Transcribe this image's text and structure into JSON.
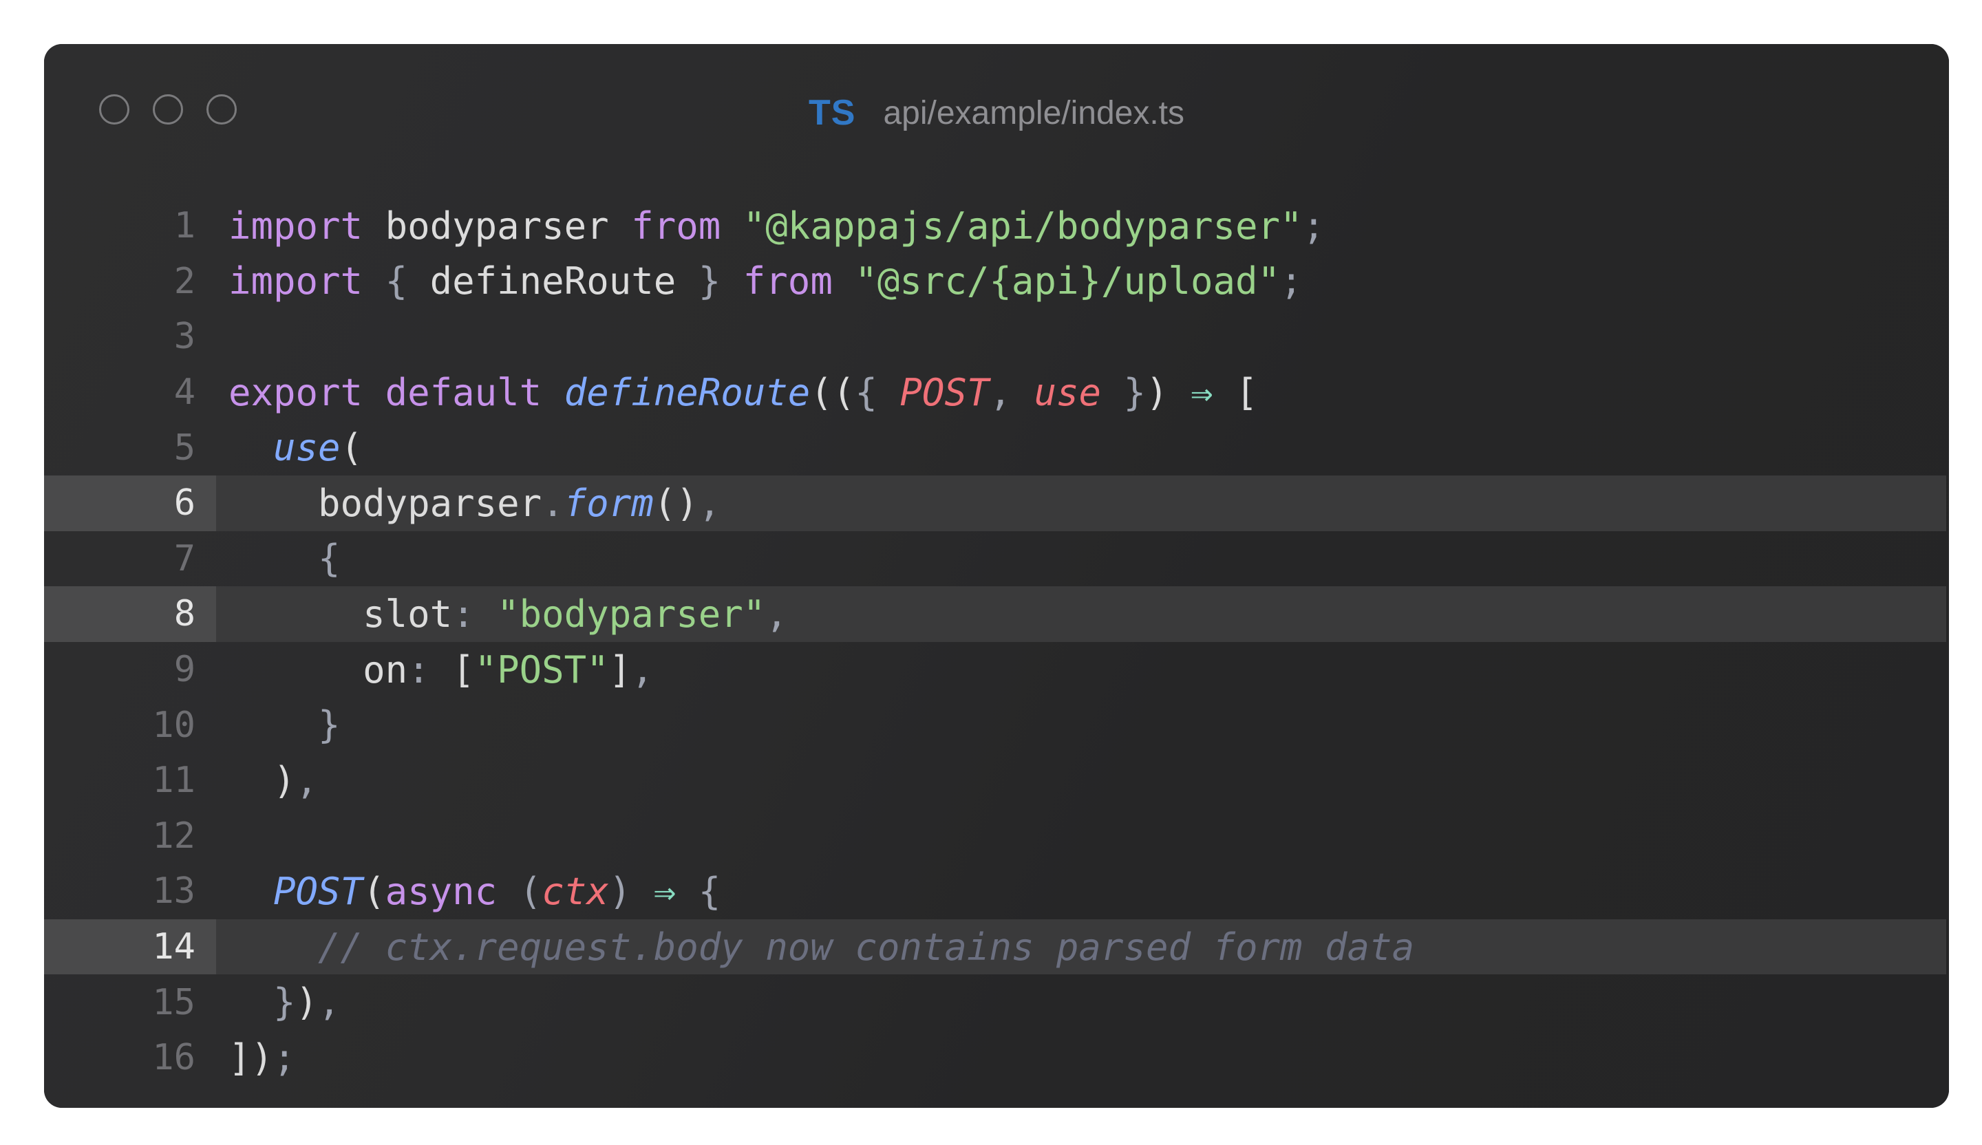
{
  "window": {
    "lang_badge": "TS",
    "file_path": "api/example/index.ts"
  },
  "colors": {
    "background": "#252526",
    "keyword": "#c792ea",
    "string": "#9ad28a",
    "function": "#82aaff",
    "parameter": "#f07178",
    "comment": "#6b6f80",
    "operator": "#89ddc2",
    "ts_badge": "#3178c6"
  },
  "code": {
    "highlighted_lines": [
      6,
      8,
      14
    ],
    "lines": [
      {
        "n": "1",
        "tokens": [
          [
            "kw",
            "import"
          ],
          [
            "plain",
            " bodyparser "
          ],
          [
            "kw",
            "from"
          ],
          [
            "plain",
            " "
          ],
          [
            "str",
            "\"@kappajs/api/bodyparser\""
          ],
          [
            "punc",
            ";"
          ]
        ]
      },
      {
        "n": "2",
        "tokens": [
          [
            "kw",
            "import"
          ],
          [
            "plain",
            " "
          ],
          [
            "punc",
            "{"
          ],
          [
            "plain",
            " defineRoute "
          ],
          [
            "punc",
            "}"
          ],
          [
            "plain",
            " "
          ],
          [
            "kw",
            "from"
          ],
          [
            "plain",
            " "
          ],
          [
            "str",
            "\"@src/{api}/upload\""
          ],
          [
            "punc",
            ";"
          ]
        ]
      },
      {
        "n": "3",
        "tokens": []
      },
      {
        "n": "4",
        "tokens": [
          [
            "kw",
            "export"
          ],
          [
            "plain",
            " "
          ],
          [
            "kw",
            "default"
          ],
          [
            "plain",
            " "
          ],
          [
            "fn",
            "defineRoute"
          ],
          [
            "plain",
            "(("
          ],
          [
            "punc",
            "{"
          ],
          [
            "plain",
            " "
          ],
          [
            "param",
            "POST"
          ],
          [
            "punc",
            ","
          ],
          [
            "plain",
            " "
          ],
          [
            "param",
            "use"
          ],
          [
            "plain",
            " "
          ],
          [
            "punc",
            "}"
          ],
          [
            "plain",
            ")"
          ],
          [
            "plain",
            " "
          ],
          [
            "op",
            "⇒"
          ],
          [
            "plain",
            " ["
          ]
        ]
      },
      {
        "n": "5",
        "tokens": [
          [
            "plain",
            "  "
          ],
          [
            "fn",
            "use"
          ],
          [
            "plain",
            "("
          ]
        ]
      },
      {
        "n": "6",
        "tokens": [
          [
            "plain",
            "    bodyparser"
          ],
          [
            "punc",
            "."
          ],
          [
            "fn",
            "form"
          ],
          [
            "plain",
            "()"
          ],
          [
            "punc",
            ","
          ]
        ]
      },
      {
        "n": "7",
        "tokens": [
          [
            "plain",
            "    "
          ],
          [
            "punc",
            "{"
          ]
        ]
      },
      {
        "n": "8",
        "tokens": [
          [
            "plain",
            "      slot"
          ],
          [
            "punc",
            ":"
          ],
          [
            "plain",
            " "
          ],
          [
            "str",
            "\"bodyparser\""
          ],
          [
            "punc",
            ","
          ]
        ]
      },
      {
        "n": "9",
        "tokens": [
          [
            "plain",
            "      on"
          ],
          [
            "punc",
            ":"
          ],
          [
            "plain",
            " ["
          ],
          [
            "str",
            "\"POST\""
          ],
          [
            "plain",
            "]"
          ],
          [
            "punc",
            ","
          ]
        ]
      },
      {
        "n": "10",
        "tokens": [
          [
            "plain",
            "    "
          ],
          [
            "punc",
            "}"
          ]
        ]
      },
      {
        "n": "11",
        "tokens": [
          [
            "plain",
            "  )"
          ],
          [
            "punc",
            ","
          ]
        ]
      },
      {
        "n": "12",
        "tokens": []
      },
      {
        "n": "13",
        "tokens": [
          [
            "plain",
            "  "
          ],
          [
            "fn",
            "POST"
          ],
          [
            "plain",
            "("
          ],
          [
            "kw",
            "async"
          ],
          [
            "plain",
            " "
          ],
          [
            "punc",
            "("
          ],
          [
            "param",
            "ctx"
          ],
          [
            "punc",
            ")"
          ],
          [
            "plain",
            " "
          ],
          [
            "op",
            "⇒"
          ],
          [
            "plain",
            " "
          ],
          [
            "punc",
            "{"
          ]
        ]
      },
      {
        "n": "14",
        "tokens": [
          [
            "plain",
            "    "
          ],
          [
            "cmt",
            "// ctx.request.body now contains parsed form data"
          ]
        ]
      },
      {
        "n": "15",
        "tokens": [
          [
            "plain",
            "  "
          ],
          [
            "punc",
            "}"
          ],
          [
            "plain",
            ")"
          ],
          [
            "punc",
            ","
          ]
        ]
      },
      {
        "n": "16",
        "tokens": [
          [
            "plain",
            "])"
          ],
          [
            "punc",
            ";"
          ]
        ]
      }
    ]
  }
}
